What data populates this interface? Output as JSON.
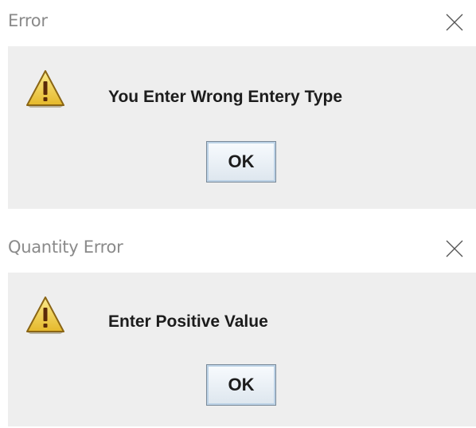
{
  "dialogs": [
    {
      "title": "Error",
      "message": "You Enter Wrong Entery Type",
      "ok_label": "OK",
      "icon": "warning-icon"
    },
    {
      "title": "Quantity Error",
      "message": "Enter Positive Value",
      "ok_label": "OK",
      "icon": "warning-icon"
    }
  ],
  "colors": {
    "dialog_background": "#eeeeee",
    "title_text": "#8a8a8a",
    "warning_fill": "#f2d653",
    "warning_outline": "#7a5c14"
  }
}
